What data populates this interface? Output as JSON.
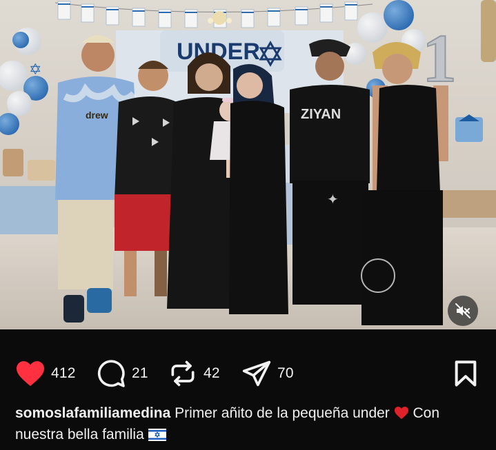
{
  "post": {
    "banner_text": "UNDER",
    "sign_digit": "1",
    "shirt_texts": [
      "drew",
      "ZIYAN"
    ],
    "photo_alt_description": "",
    "actions": {
      "likes": "412",
      "comments": "21",
      "reposts": "42",
      "shares": "70"
    },
    "caption": {
      "username": "somoslafamiliamedina",
      "text_part1": "Primer añito de la pequeña under",
      "text_part2": "Con nuestra bella familia"
    }
  },
  "icons": {
    "like": "heart-icon",
    "comment": "comment-icon",
    "repost": "repost-icon",
    "share": "send-icon",
    "bookmark": "bookmark-icon",
    "mute": "muted-speaker-icon"
  },
  "colors": {
    "background": "#0b0b0b",
    "heart": "#ff3040",
    "text": "#f2f2f2"
  }
}
